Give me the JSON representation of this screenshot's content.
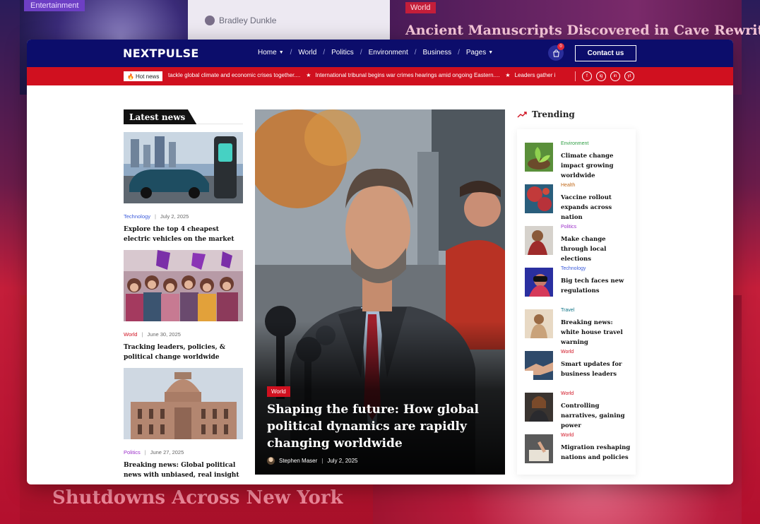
{
  "background": {
    "badge_entertainment": "Entertainment",
    "author": "Bradley Dunkle",
    "badge_world": "World",
    "headline_top": "Ancient Manuscripts Discovered in Cave Rewrite",
    "headline_bottom": "Shutdowns Across New York"
  },
  "nav": {
    "logo": "NEXTPULSE",
    "menu": [
      "Home",
      "World",
      "Politics",
      "Environment",
      "Business",
      "Pages"
    ],
    "cart_count": "0",
    "contact_label": "Contact us"
  },
  "ticker": {
    "hot_label": "Hot news",
    "items": [
      "tackle global climate and economic crises together....",
      "International tribunal begins war crimes hearings amid ongoing Eastern....",
      "Leaders gather i"
    ],
    "social": [
      "f",
      "ig",
      "in",
      "yt"
    ]
  },
  "latest": {
    "heading": "Latest news",
    "items": [
      {
        "category": "Technology",
        "category_color": "#3b5bdb",
        "date": "July 2, 2025",
        "title": "Explore the top 4 cheapest electric vehicles on the market"
      },
      {
        "category": "World",
        "category_color": "#d0101f",
        "date": "June 30, 2025",
        "title": "Tracking leaders, policies, & political change worldwide"
      },
      {
        "category": "Politics",
        "category_color": "#9b2fc9",
        "date": "June 27, 2025",
        "title": "Breaking news: Global political news with unbiased, real insight"
      }
    ]
  },
  "hero": {
    "category": "World",
    "title": "Shaping the future: How global political dynamics are rapidly changing worldwide",
    "author": "Stephen Maser",
    "date": "July 2, 2025"
  },
  "trending": {
    "heading": "Trending",
    "items": [
      {
        "category": "Environment",
        "color": "#2f9e44",
        "title": "Climate change impact growing worldwide"
      },
      {
        "category": "Health",
        "color": "#c26b1c",
        "title": "Vaccine rollout expands across nation"
      },
      {
        "category": "Politics",
        "color": "#9b2fc9",
        "title": "Make change through local elections"
      },
      {
        "category": "Technology",
        "color": "#3b5bdb",
        "title": "Big tech faces new regulations"
      },
      {
        "category": "Travel",
        "color": "#0b7285",
        "title": "Breaking news: white house travel warning"
      },
      {
        "category": "World",
        "color": "#d0101f",
        "title": "Smart updates for business leaders"
      },
      {
        "category": "World",
        "color": "#d0101f",
        "title": "Controlling narratives, gaining power"
      },
      {
        "category": "World",
        "color": "#d0101f",
        "title": "Migration reshaping nations and policies"
      }
    ]
  },
  "colors": {
    "nav_bg": "#0c0d6b",
    "ticker_bg": "#d0101f",
    "accent": "#d0101f"
  }
}
